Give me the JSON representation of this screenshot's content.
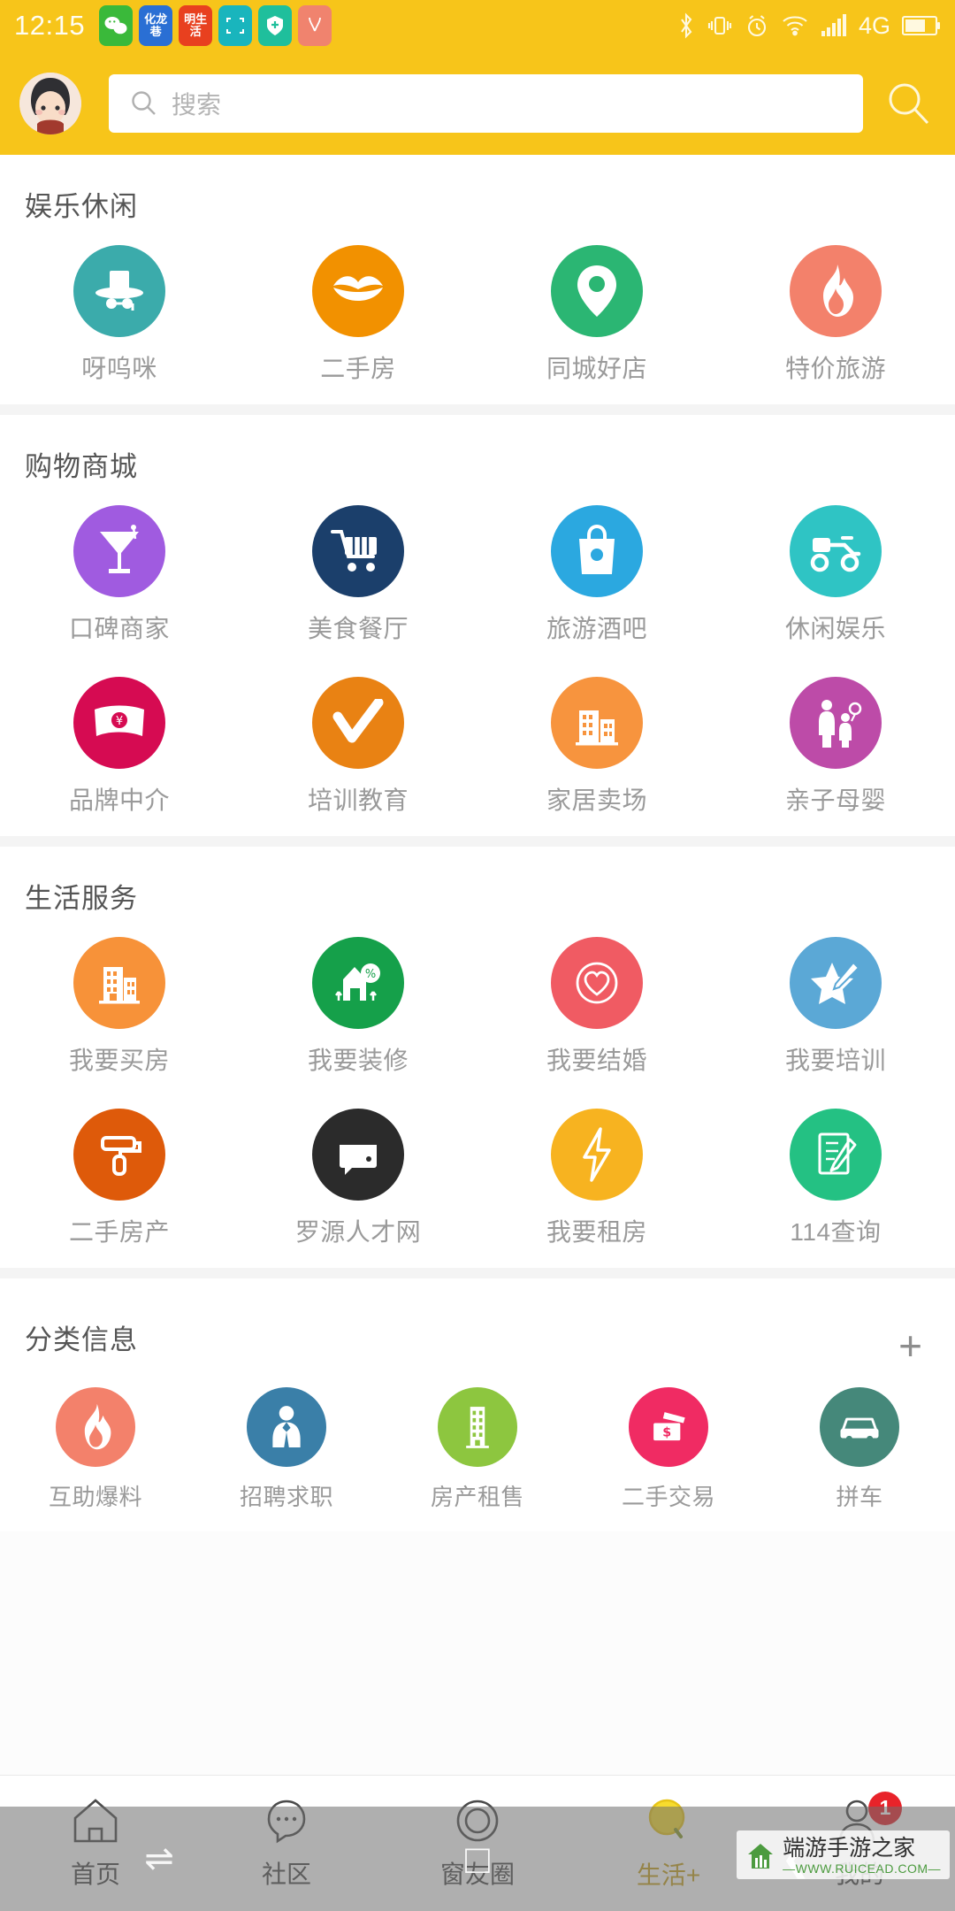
{
  "status_bar": {
    "time": "12:15",
    "apps": [
      {
        "name": "wechat",
        "color": "#3ab93a",
        "text": ""
      },
      {
        "name": "hualongxiang",
        "color": "#2a6fd4",
        "text": "化龙巷"
      },
      {
        "name": "minshenghuo",
        "color": "#e8401f",
        "text": "明生活"
      },
      {
        "name": "scanner",
        "color": "#19b5bd",
        "text": ""
      },
      {
        "name": "security",
        "color": "#1fbf9c",
        "text": ""
      },
      {
        "name": "shopping-bag",
        "color": "#f0836e",
        "text": ""
      }
    ],
    "icons": [
      "bluetooth-icon",
      "vibrate-icon",
      "alarm-icon",
      "wifi-icon",
      "signal-icon"
    ],
    "network": "4G",
    "battery": "battery-icon"
  },
  "header": {
    "avatar": "user-avatar",
    "search_placeholder": "搜索",
    "search_value": "",
    "search_button": "search-icon"
  },
  "sections": [
    {
      "title": "娱乐休闲",
      "columns": 4,
      "items": [
        {
          "label": "呀呜咪",
          "color": "#3BABAB",
          "icon": "detective-hat-icon"
        },
        {
          "label": "二手房",
          "color": "#F29100",
          "icon": "lips-icon"
        },
        {
          "label": "同城好店",
          "color": "#2BB673",
          "icon": "location-pin-icon"
        },
        {
          "label": "特价旅游",
          "color": "#F3816B",
          "icon": "flame-icon"
        }
      ]
    },
    {
      "title": "购物商城",
      "columns": 4,
      "items": [
        {
          "label": "口碑商家",
          "color": "#A05BE0",
          "icon": "cocktail-icon"
        },
        {
          "label": "美食餐厅",
          "color": "#1B3F6B",
          "icon": "shopping-cart-icon"
        },
        {
          "label": "旅游酒吧",
          "color": "#2BA8E0",
          "icon": "shopping-bag-icon"
        },
        {
          "label": "休闲娱乐",
          "color": "#2FC4C4",
          "icon": "delivery-scooter-icon"
        },
        {
          "label": "品牌中介",
          "color": "#D60B52",
          "icon": "money-bill-icon"
        },
        {
          "label": "培训教育",
          "color": "#E98213",
          "icon": "check-mark-icon"
        },
        {
          "label": "家居卖场",
          "color": "#F7943E",
          "icon": "building-icon"
        },
        {
          "label": "亲子母婴",
          "color": "#BD4BA8",
          "icon": "parent-child-icon"
        }
      ]
    },
    {
      "title": "生活服务",
      "columns": 4,
      "items": [
        {
          "label": "我要买房",
          "color": "#F79239",
          "icon": "apartment-icon"
        },
        {
          "label": "我要装修",
          "color": "#15A04A",
          "icon": "house-discount-icon"
        },
        {
          "label": "我要结婚",
          "color": "#F05B63",
          "icon": "heart-circle-icon"
        },
        {
          "label": "我要培训",
          "color": "#5BA8D6",
          "icon": "star-pen-icon"
        },
        {
          "label": "二手房产",
          "color": "#DE5A0A",
          "icon": "paint-roller-icon"
        },
        {
          "label": "罗源人才网",
          "color": "#2B2B2B",
          "icon": "wallet-icon"
        },
        {
          "label": "我要租房",
          "color": "#F7B320",
          "icon": "lightning-icon"
        },
        {
          "label": "114查询",
          "color": "#24C183",
          "icon": "note-pen-icon"
        }
      ]
    },
    {
      "title": "分类信息",
      "columns": 5,
      "add_button": "+",
      "items": [
        {
          "label": "互助爆料",
          "color": "#F3816B",
          "icon": "flame-icon"
        },
        {
          "label": "招聘求职",
          "color": "#3A7FA8",
          "icon": "person-tie-icon"
        },
        {
          "label": "房产租售",
          "color": "#8DC63F",
          "icon": "tower-building-icon"
        },
        {
          "label": "二手交易",
          "color": "#F02B63",
          "icon": "price-tag-icon"
        },
        {
          "label": "拼车",
          "color": "#45887A",
          "icon": "car-icon"
        }
      ]
    }
  ],
  "bottom_nav": {
    "items": [
      {
        "label": "首页",
        "icon": "home-icon",
        "active": false,
        "badge": ""
      },
      {
        "label": "社区",
        "icon": "chat-icon",
        "active": false,
        "badge": ""
      },
      {
        "label": "窗友圈",
        "icon": "circle-icon",
        "active": false,
        "badge": ""
      },
      {
        "label": "生活+",
        "icon": "life-plus-icon",
        "active": true,
        "badge": ""
      },
      {
        "label": "我的",
        "icon": "person-icon",
        "active": false,
        "badge": "1"
      }
    ],
    "active_color": "#C6A11E",
    "badge_color": "#e8232a"
  },
  "system_nav": {
    "glyphs": [
      "recent-apps-icon",
      "home-indicator-icon",
      "back-icon"
    ]
  },
  "watermark": {
    "main": "端游手游之家",
    "sub": "—WWW.RUICEAD.COM—"
  }
}
